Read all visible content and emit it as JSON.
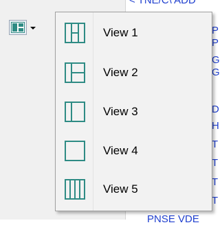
{
  "toolbar": {
    "view_button_icon": "view-layout-icon",
    "dropdown_icon": "chevron-down-icon"
  },
  "background": {
    "top_text": "< TNE/C\\ ADD",
    "right_letters": [
      "P",
      "P",
      "G",
      "G",
      "D",
      "H",
      "T",
      "T",
      "T",
      "T"
    ],
    "bottom_text": "PNSE  VDE"
  },
  "menu": {
    "items": [
      {
        "label": "View 1",
        "icon": "view-1-layout-icon"
      },
      {
        "label": "View 2",
        "icon": "view-2-layout-icon"
      },
      {
        "label": "View 3",
        "icon": "view-3-layout-icon"
      },
      {
        "label": "View 4",
        "icon": "view-4-layout-icon"
      },
      {
        "label": "View 5",
        "icon": "view-5-layout-icon"
      }
    ]
  },
  "colors": {
    "accent": "#2e8b84",
    "link": "#1f3fcf",
    "menu_bg": "#f2f2f2"
  }
}
